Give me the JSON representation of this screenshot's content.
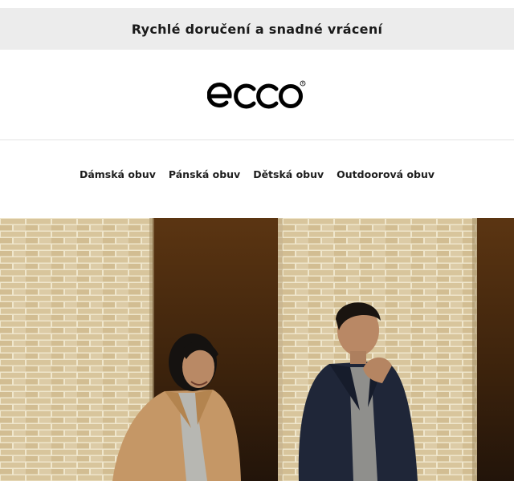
{
  "promo": {
    "text": "Rychlé doručení a snadné vrácení"
  },
  "logo": {
    "text": "ecco",
    "icon": "ecco-logo"
  },
  "nav": {
    "items": [
      {
        "label": "Dámská obuv"
      },
      {
        "label": "Pánská obuv"
      },
      {
        "label": "Dětská obuv"
      },
      {
        "label": "Outdoorová obuv"
      }
    ]
  },
  "hero": {
    "colors": {
      "brick": "#d9c7a0",
      "mortar": "#efe6cc",
      "shadow": "#3a2410",
      "coat_camel": "#c89a68",
      "coat_navy": "#1d2433"
    }
  }
}
